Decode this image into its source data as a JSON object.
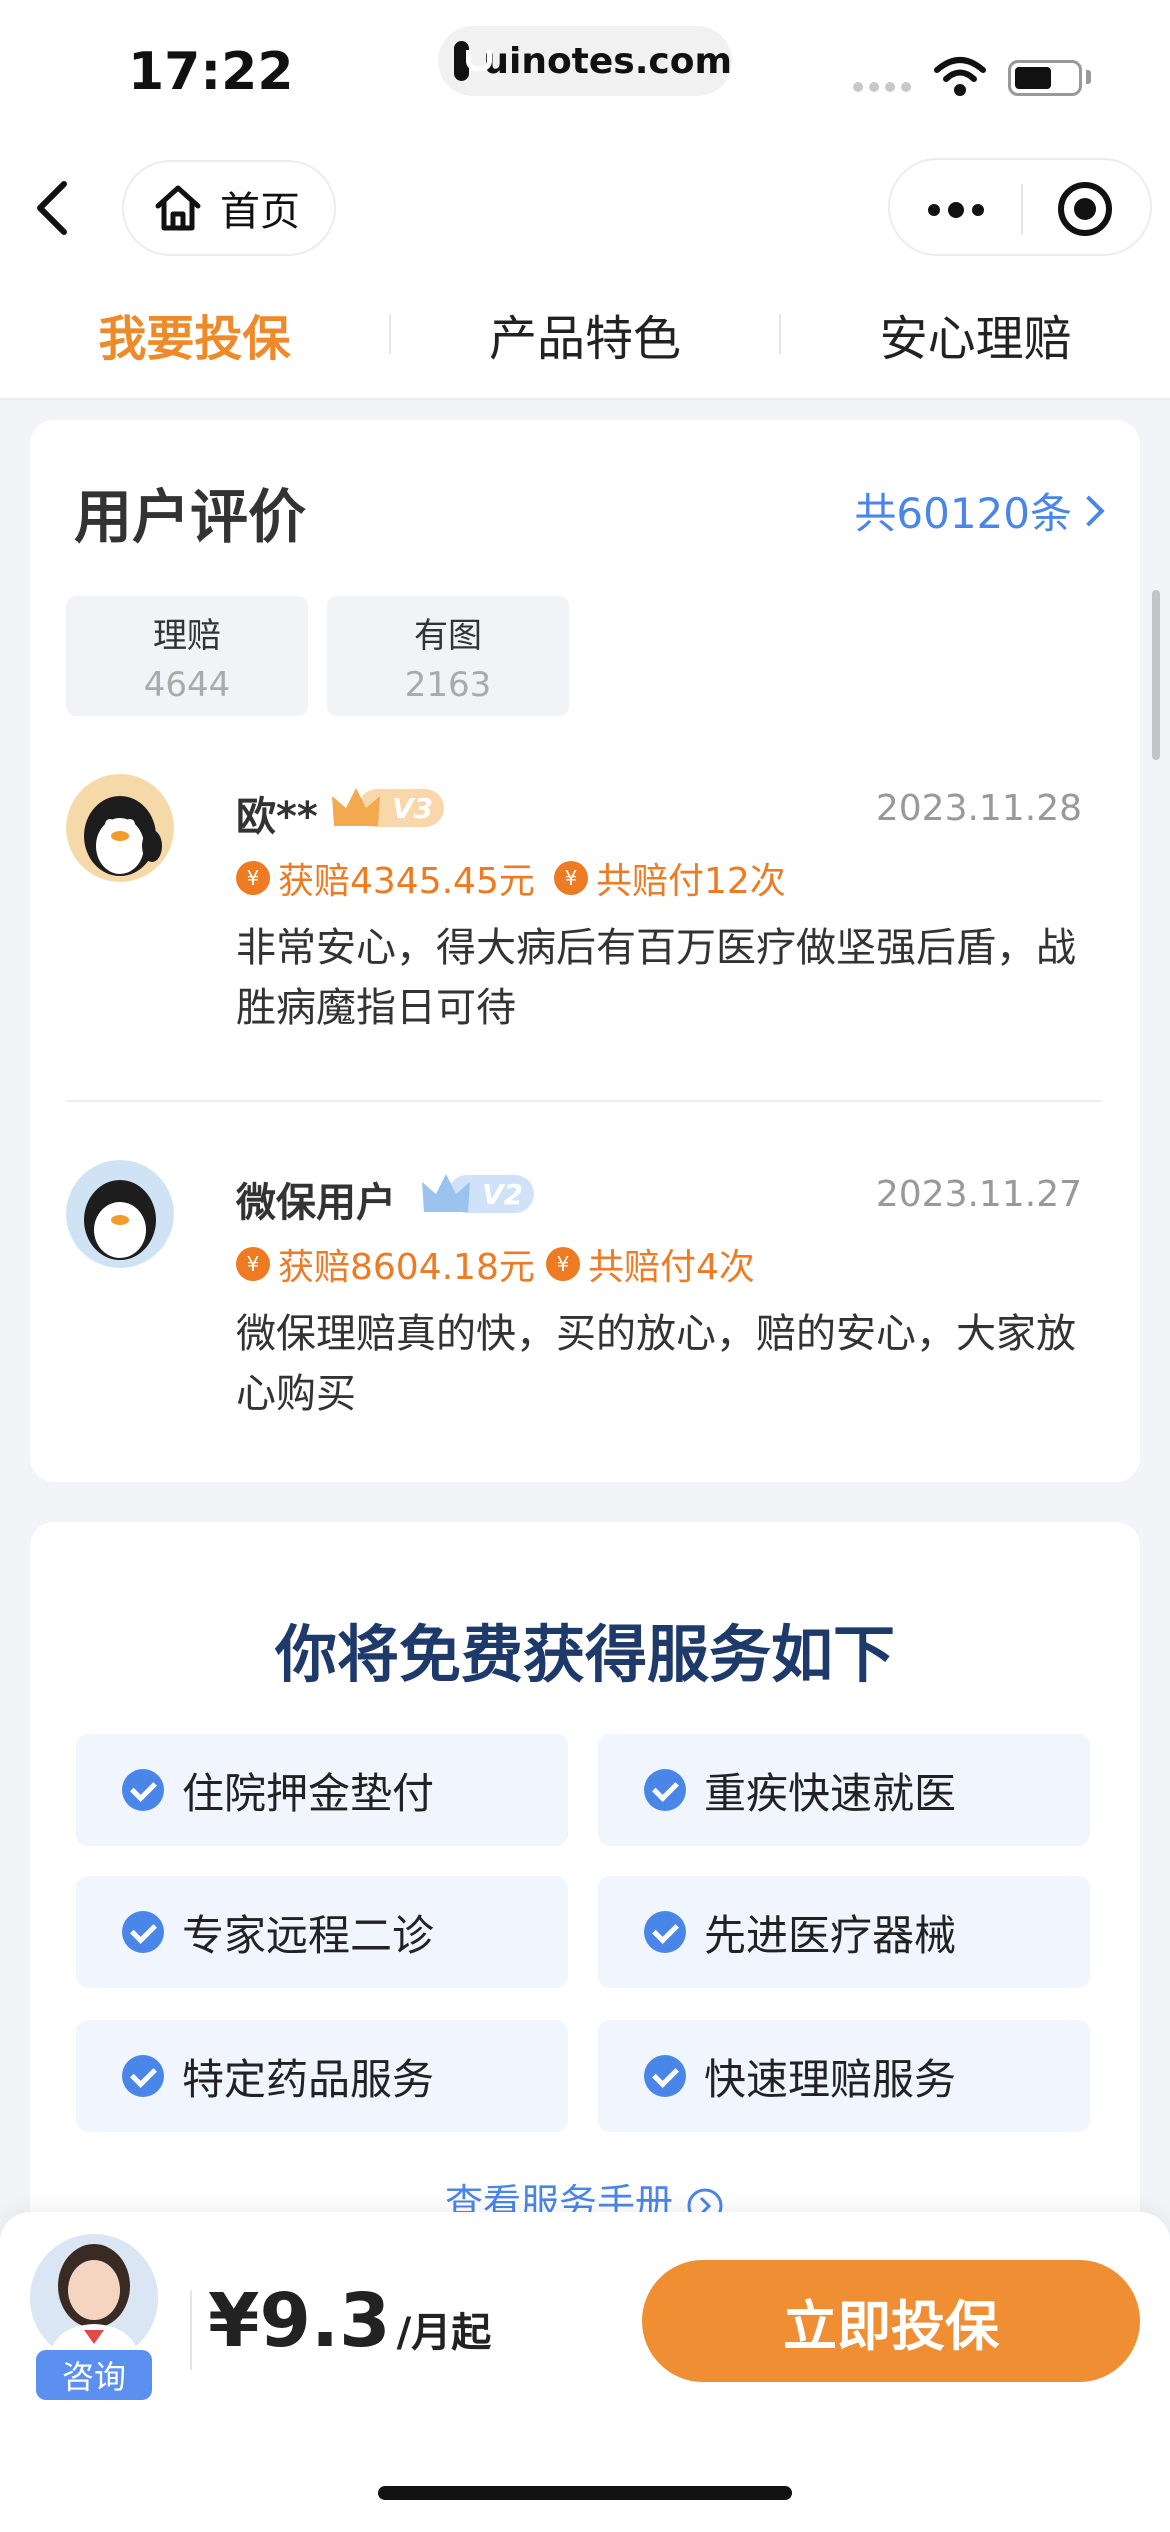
{
  "status_bar": {
    "time": "17:22",
    "url": "uinotes.com"
  },
  "navbar": {
    "home_label": "首页"
  },
  "tabs": [
    {
      "label": "我要投保",
      "active": true
    },
    {
      "label": "产品特色",
      "active": false
    },
    {
      "label": "安心理赔",
      "active": false
    }
  ],
  "reviews": {
    "title": "用户评价",
    "total_link": "共60120条",
    "filters": [
      {
        "label": "理赔",
        "count": "4644"
      },
      {
        "label": "有图",
        "count": "2163"
      }
    ],
    "items": [
      {
        "name": "欧**",
        "level": "V3",
        "date": "2023.11.28",
        "tags": [
          "获赔4345.45元",
          "共赔付12次"
        ],
        "text": "非常安心，得大病后有百万医疗做坚强后盾，战胜病魔指日可待"
      },
      {
        "name": "微保用户",
        "level": "V2",
        "date": "2023.11.27",
        "tags": [
          "获赔8604.18元",
          "共赔付4次"
        ],
        "text": "微保理赔真的快，买的放心，赔的安心，大家放心购买"
      }
    ],
    "yen_symbol": "¥"
  },
  "services": {
    "title": "你将免费获得服务如下",
    "items": [
      "住院押金垫付",
      "重疾快速就医",
      "专家远程二诊",
      "先进医疗器械",
      "特定药品服务",
      "快速理赔服务"
    ],
    "manual_link": "查看服务手册"
  },
  "bottom_bar": {
    "consult_label": "咨询",
    "price": "¥9.3",
    "price_unit": "/月起",
    "cta_label": "立即投保"
  },
  "colors": {
    "accent_orange": "#ee8a2a",
    "link_blue": "#4a86e8",
    "services_title": "#1d3a6b",
    "cta": "#f08e33"
  },
  "icons": [
    "back-chevron-icon",
    "home-icon",
    "more-dots-icon",
    "target-icon",
    "chevron-right-icon",
    "crown-icon",
    "yen-icon",
    "check-circle-icon",
    "arrow-circle-icon"
  ]
}
